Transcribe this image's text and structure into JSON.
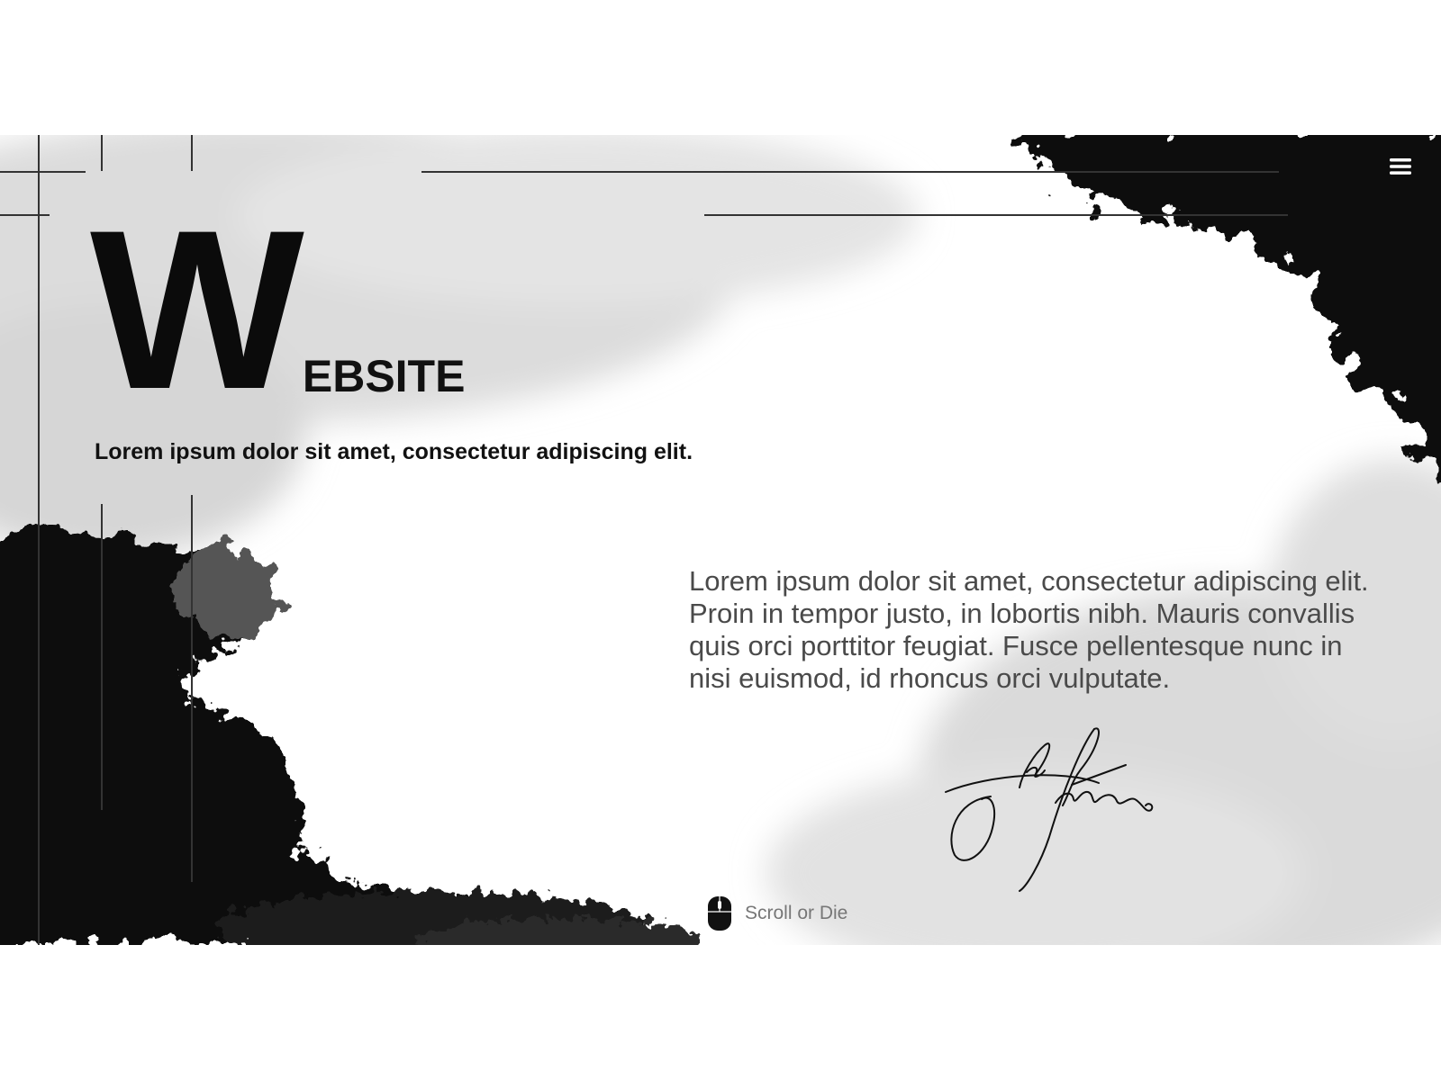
{
  "hero": {
    "title_initial": "W",
    "title_rest": "EBSITE",
    "subtitle": "Lorem ipsum dolor sit amet, consectetur adipiscing elit.",
    "body": "Lorem ipsum dolor sit amet, consectetur adipiscing elit. Proin in tempor justo, in lobortis nibh. Mauris convallis quis orci porttitor feugiat. Fusce pellentesque nunc in nisi euismod, id rhoncus orci vulputate."
  },
  "nav": {
    "menu_icon": "hamburger-menu-icon"
  },
  "scroll_hint": {
    "label": "Scroll or Die",
    "icon": "mouse-icon"
  },
  "signature": {
    "icon": "handwritten-signature"
  },
  "colors": {
    "ink": "#0b0b0b",
    "body_text": "#4a4a4a",
    "muted_text": "#777777",
    "wash": "#d8d8d8",
    "background": "#ffffff"
  }
}
